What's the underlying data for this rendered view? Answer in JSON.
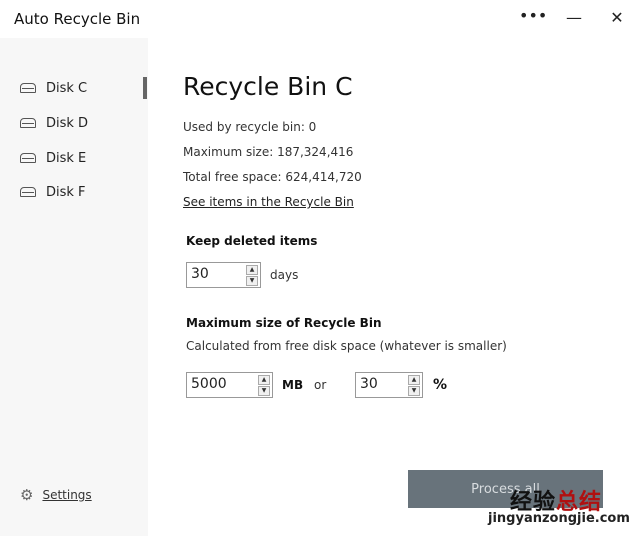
{
  "app": {
    "title": "Auto Recycle Bin",
    "more": "•••",
    "minimize": "—",
    "close": "✕"
  },
  "sidebar": {
    "items": [
      {
        "label": "Disk C",
        "selected": true
      },
      {
        "label": "Disk D"
      },
      {
        "label": "Disk E"
      },
      {
        "label": "Disk F"
      }
    ],
    "settings": "Settings"
  },
  "main": {
    "title": "Recycle Bin C",
    "used": "Used by recycle bin: 0",
    "max": "Maximum size: 187,324,416",
    "free": "Total free space: 624,414,720",
    "link": "See items in the Recycle Bin",
    "keep_label": "Keep deleted items",
    "keep_value": "30",
    "keep_unit": "days",
    "max_label": "Maximum size of Recycle Bin",
    "max_desc": "Calculated from free disk space (whatever is smaller)",
    "mb_value": "5000",
    "mb_unit": "MB",
    "or": "or",
    "pct_value": "30",
    "pct_unit": "%",
    "process": "Process all"
  },
  "watermark": {
    "a": "经验",
    "b": "总结",
    "site": "jingyanzongjie.com"
  }
}
